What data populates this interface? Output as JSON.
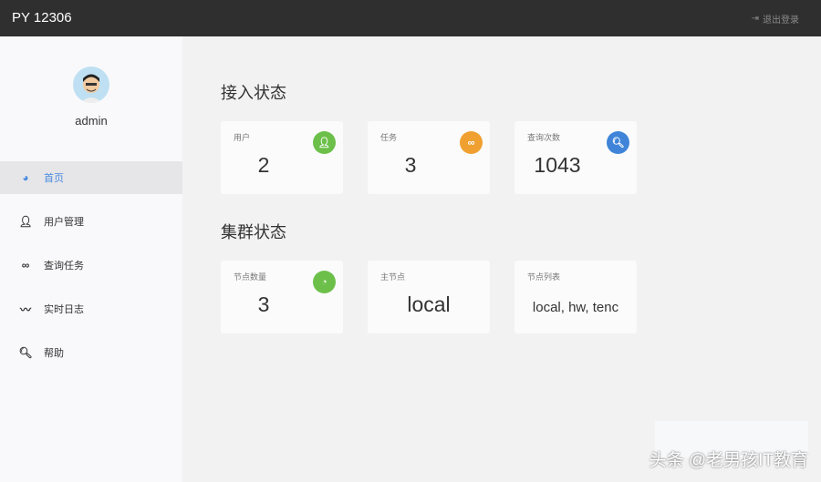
{
  "header": {
    "brand": "PY 12306",
    "logout_label": "退出登录"
  },
  "sidebar": {
    "username": "admin",
    "items": [
      {
        "label": "首页",
        "icon": "dashboard-icon",
        "active": true
      },
      {
        "label": "用户管理",
        "icon": "user-icon"
      },
      {
        "label": "查询任务",
        "icon": "infinity-icon"
      },
      {
        "label": "实时日志",
        "icon": "signature-icon"
      },
      {
        "label": "帮助",
        "icon": "search-icon"
      }
    ]
  },
  "access": {
    "title": "接入状态",
    "cards": [
      {
        "label": "用户",
        "value": "2",
        "color": "#6cc04a"
      },
      {
        "label": "任务",
        "value": "3",
        "color": "#f0a030"
      },
      {
        "label": "查询次数",
        "value": "1043",
        "color": "#3f84d8"
      }
    ]
  },
  "cluster": {
    "title": "集群状态",
    "cards": [
      {
        "label": "节点数量",
        "value": "3",
        "color": "#6cc04a"
      },
      {
        "label": "主节点",
        "value": "local"
      },
      {
        "label": "节点列表",
        "value": "local, hw, tenc"
      }
    ]
  },
  "watermark": "头条 @老男孩IT教育"
}
